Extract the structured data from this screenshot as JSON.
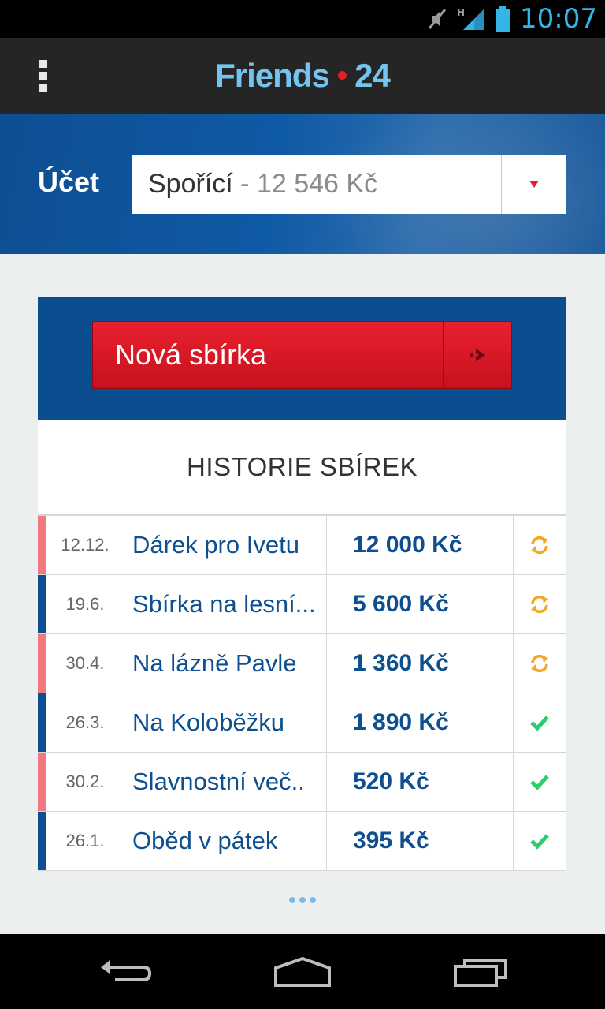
{
  "status_bar": {
    "time": "10:07",
    "icons": [
      "mute-icon",
      "signal-h-icon",
      "battery-icon"
    ]
  },
  "app_bar": {
    "menu_icon": "overflow-menu-icon",
    "brand_name": "Friends",
    "brand_number": "24",
    "brand_colors": {
      "text": "#74c4f0",
      "dot": "#e2202a"
    }
  },
  "account": {
    "label": "Účet",
    "selected_name": "Spořící",
    "separator": "-",
    "selected_balance": "12 546 Kč",
    "dropdown_icon": "triangle-down-icon"
  },
  "new_collection": {
    "label": "Nová sbírka",
    "icon": "arrow-right-icon"
  },
  "history": {
    "title": "HISTORIE SBÍREK",
    "rows": [
      {
        "date": "12.12.",
        "name": "Dárek pro Ivetu",
        "amount": "12 000 Kč",
        "status": "refresh-icon",
        "accent": "#f07a80"
      },
      {
        "date": "19.6.",
        "name": "Sbírka na lesní...",
        "amount": "5 600 Kč",
        "status": "refresh-icon",
        "accent": "#0d4f8f"
      },
      {
        "date": "30.4.",
        "name": "Na lázně Pavle",
        "amount": "1 360 Kč",
        "status": "refresh-icon",
        "accent": "#f07a80"
      },
      {
        "date": "26.3.",
        "name": "Na Koloběžku",
        "amount": "1 890 Kč",
        "status": "check-icon",
        "accent": "#0d4f8f"
      },
      {
        "date": "30.2.",
        "name": "Slavnostní več..",
        "amount": "520 Kč",
        "status": "check-icon",
        "accent": "#f07a80"
      },
      {
        "date": "26.1.",
        "name": "Oběd v pátek",
        "amount": "395 Kč",
        "status": "check-icon",
        "accent": "#0d4f8f"
      }
    ]
  },
  "colors": {
    "primary_blue": "#0a4e8f",
    "action_red": "#e2202a",
    "pending_orange": "#f5a623",
    "done_green": "#2ecc71"
  },
  "nav_bar": {
    "buttons": [
      "back-icon",
      "home-icon",
      "recent-apps-icon"
    ]
  }
}
